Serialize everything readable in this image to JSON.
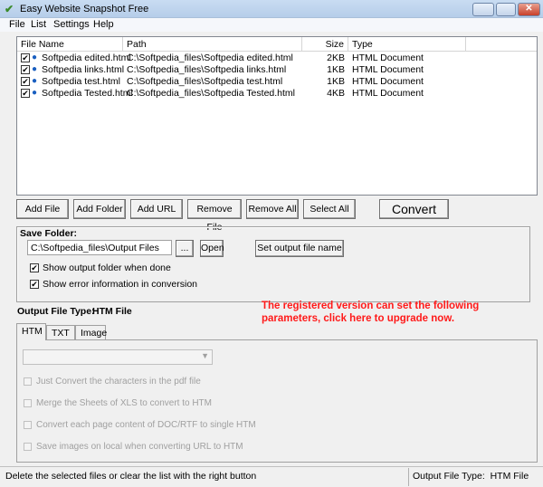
{
  "window": {
    "title": "Easy Website Snapshot Free"
  },
  "menu": [
    "File",
    "List",
    "Settings",
    "Help"
  ],
  "list": {
    "columns": [
      "File Name",
      "Path",
      "Size",
      "Type"
    ],
    "rows": [
      {
        "checked": true,
        "name": "Softpedia edited.html",
        "path": "C:\\Softpedia_files\\Softpedia edited.html",
        "size": "2KB",
        "type": "HTML Document"
      },
      {
        "checked": true,
        "name": "Softpedia links.html",
        "path": "C:\\Softpedia_files\\Softpedia links.html",
        "size": "1KB",
        "type": "HTML Document"
      },
      {
        "checked": true,
        "name": "Softpedia test.html",
        "path": "C:\\Softpedia_files\\Softpedia test.html",
        "size": "1KB",
        "type": "HTML Document"
      },
      {
        "checked": true,
        "name": "Softpedia Tested.html",
        "path": "C:\\Softpedia_files\\Softpedia Tested.html",
        "size": "4KB",
        "type": "HTML Document"
      }
    ]
  },
  "buttons": {
    "add_file": "Add File",
    "add_folder": "Add Folder",
    "add_url": "Add URL",
    "remove_file": "Remove File",
    "remove_all": "Remove All",
    "select_all": "Select All",
    "convert": "Convert"
  },
  "save": {
    "label": "Save Folder:",
    "path": "C:\\Softpedia_files\\Output Files",
    "browse": "...",
    "open": "Open",
    "set_name": "Set output file name",
    "show_folder": "Show output folder when done",
    "show_error": "Show error information in conversion"
  },
  "output": {
    "label": "Output File Type:",
    "value": "HTM File"
  },
  "upgrade": {
    "line1": "The registered version can set the following",
    "line2": "parameters, click here to upgrade now.",
    "color": "#ff1a1a"
  },
  "tabs": [
    "HTM",
    "TXT",
    "Image"
  ],
  "options": [
    "Just Convert the characters in the pdf file",
    "Merge the Sheets of XLS to convert to HTM",
    "Convert each page content of DOC/RTF to single HTM",
    "Save images on local when converting URL to HTM"
  ],
  "status": {
    "hint": "Delete the selected files or clear the list with the right button",
    "type": "Output File Type:  HTM File"
  }
}
